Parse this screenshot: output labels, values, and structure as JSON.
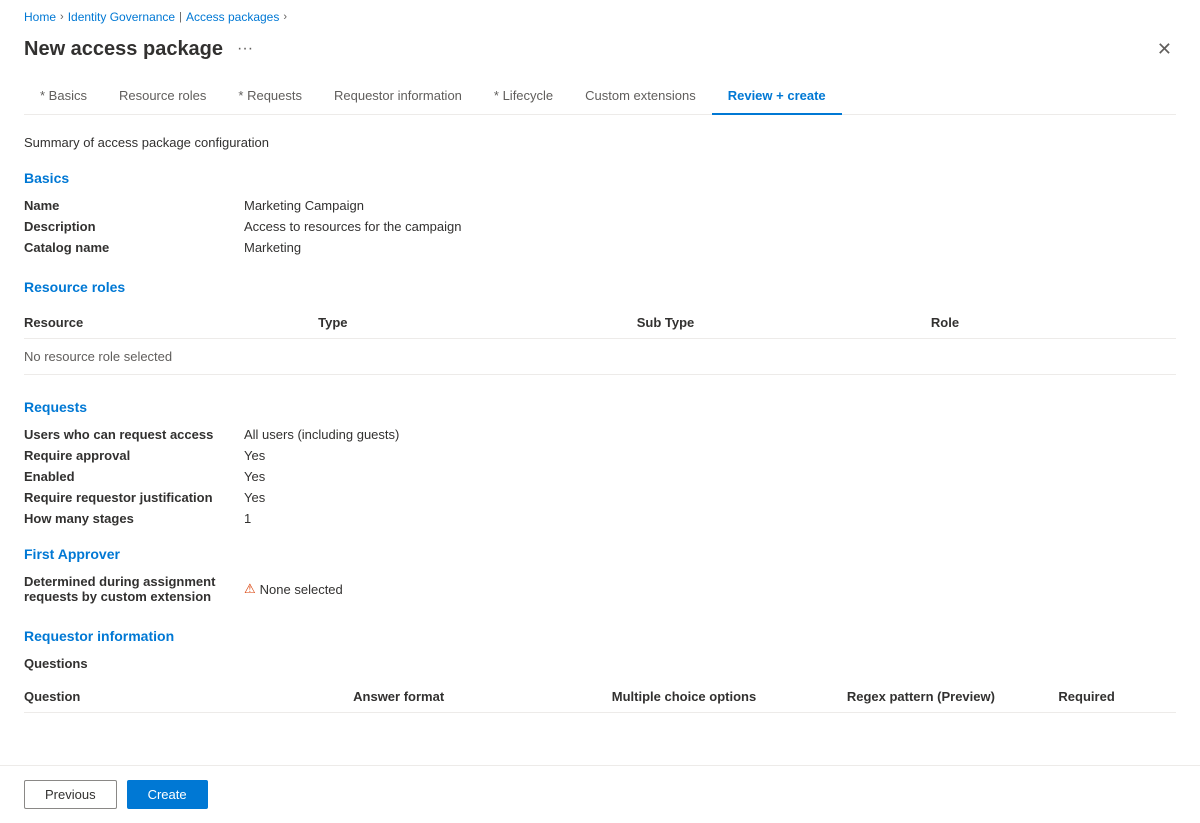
{
  "breadcrumb": {
    "home": "Home",
    "identity_governance": "Identity Governance",
    "access_packages": "Access packages"
  },
  "page": {
    "title": "New access package",
    "summary_text": "Summary of access package configuration"
  },
  "tabs": [
    {
      "id": "basics",
      "label": "* Basics",
      "active": false
    },
    {
      "id": "resource-roles",
      "label": "Resource roles",
      "active": false
    },
    {
      "id": "requests",
      "label": "* Requests",
      "active": false
    },
    {
      "id": "requestor-information",
      "label": "Requestor information",
      "active": false
    },
    {
      "id": "lifecycle",
      "label": "* Lifecycle",
      "active": false
    },
    {
      "id": "custom-extensions",
      "label": "Custom extensions",
      "active": false
    },
    {
      "id": "review-create",
      "label": "Review + create",
      "active": true
    }
  ],
  "basics": {
    "section_title": "Basics",
    "fields": [
      {
        "label": "Name",
        "value": "Marketing Campaign"
      },
      {
        "label": "Description",
        "value": "Access to resources for the campaign"
      },
      {
        "label": "Catalog name",
        "value": "Marketing"
      }
    ]
  },
  "resource_roles": {
    "section_title": "Resource roles",
    "table_headers": [
      "Resource",
      "Type",
      "Sub Type",
      "Role"
    ],
    "no_data_message": "No resource role selected"
  },
  "requests": {
    "section_title": "Requests",
    "fields": [
      {
        "label": "Users who can request access",
        "value": "All users (including guests)"
      },
      {
        "label": "Require approval",
        "value": "Yes"
      },
      {
        "label": "Enabled",
        "value": "Yes"
      },
      {
        "label": "Require requestor justification",
        "value": "Yes"
      },
      {
        "label": "How many stages",
        "value": "1"
      }
    ]
  },
  "first_approver": {
    "section_title": "First Approver",
    "field_label": "Determined during assignment requests by custom extension",
    "warning_icon": "⚠",
    "none_selected_text": "None selected"
  },
  "requestor_information": {
    "section_title": "Requestor information",
    "questions_label": "Questions",
    "table_headers": [
      "Question",
      "Answer format",
      "Multiple choice options",
      "Regex pattern (Preview)",
      "Required"
    ]
  },
  "footer": {
    "previous_label": "Previous",
    "create_label": "Create"
  }
}
